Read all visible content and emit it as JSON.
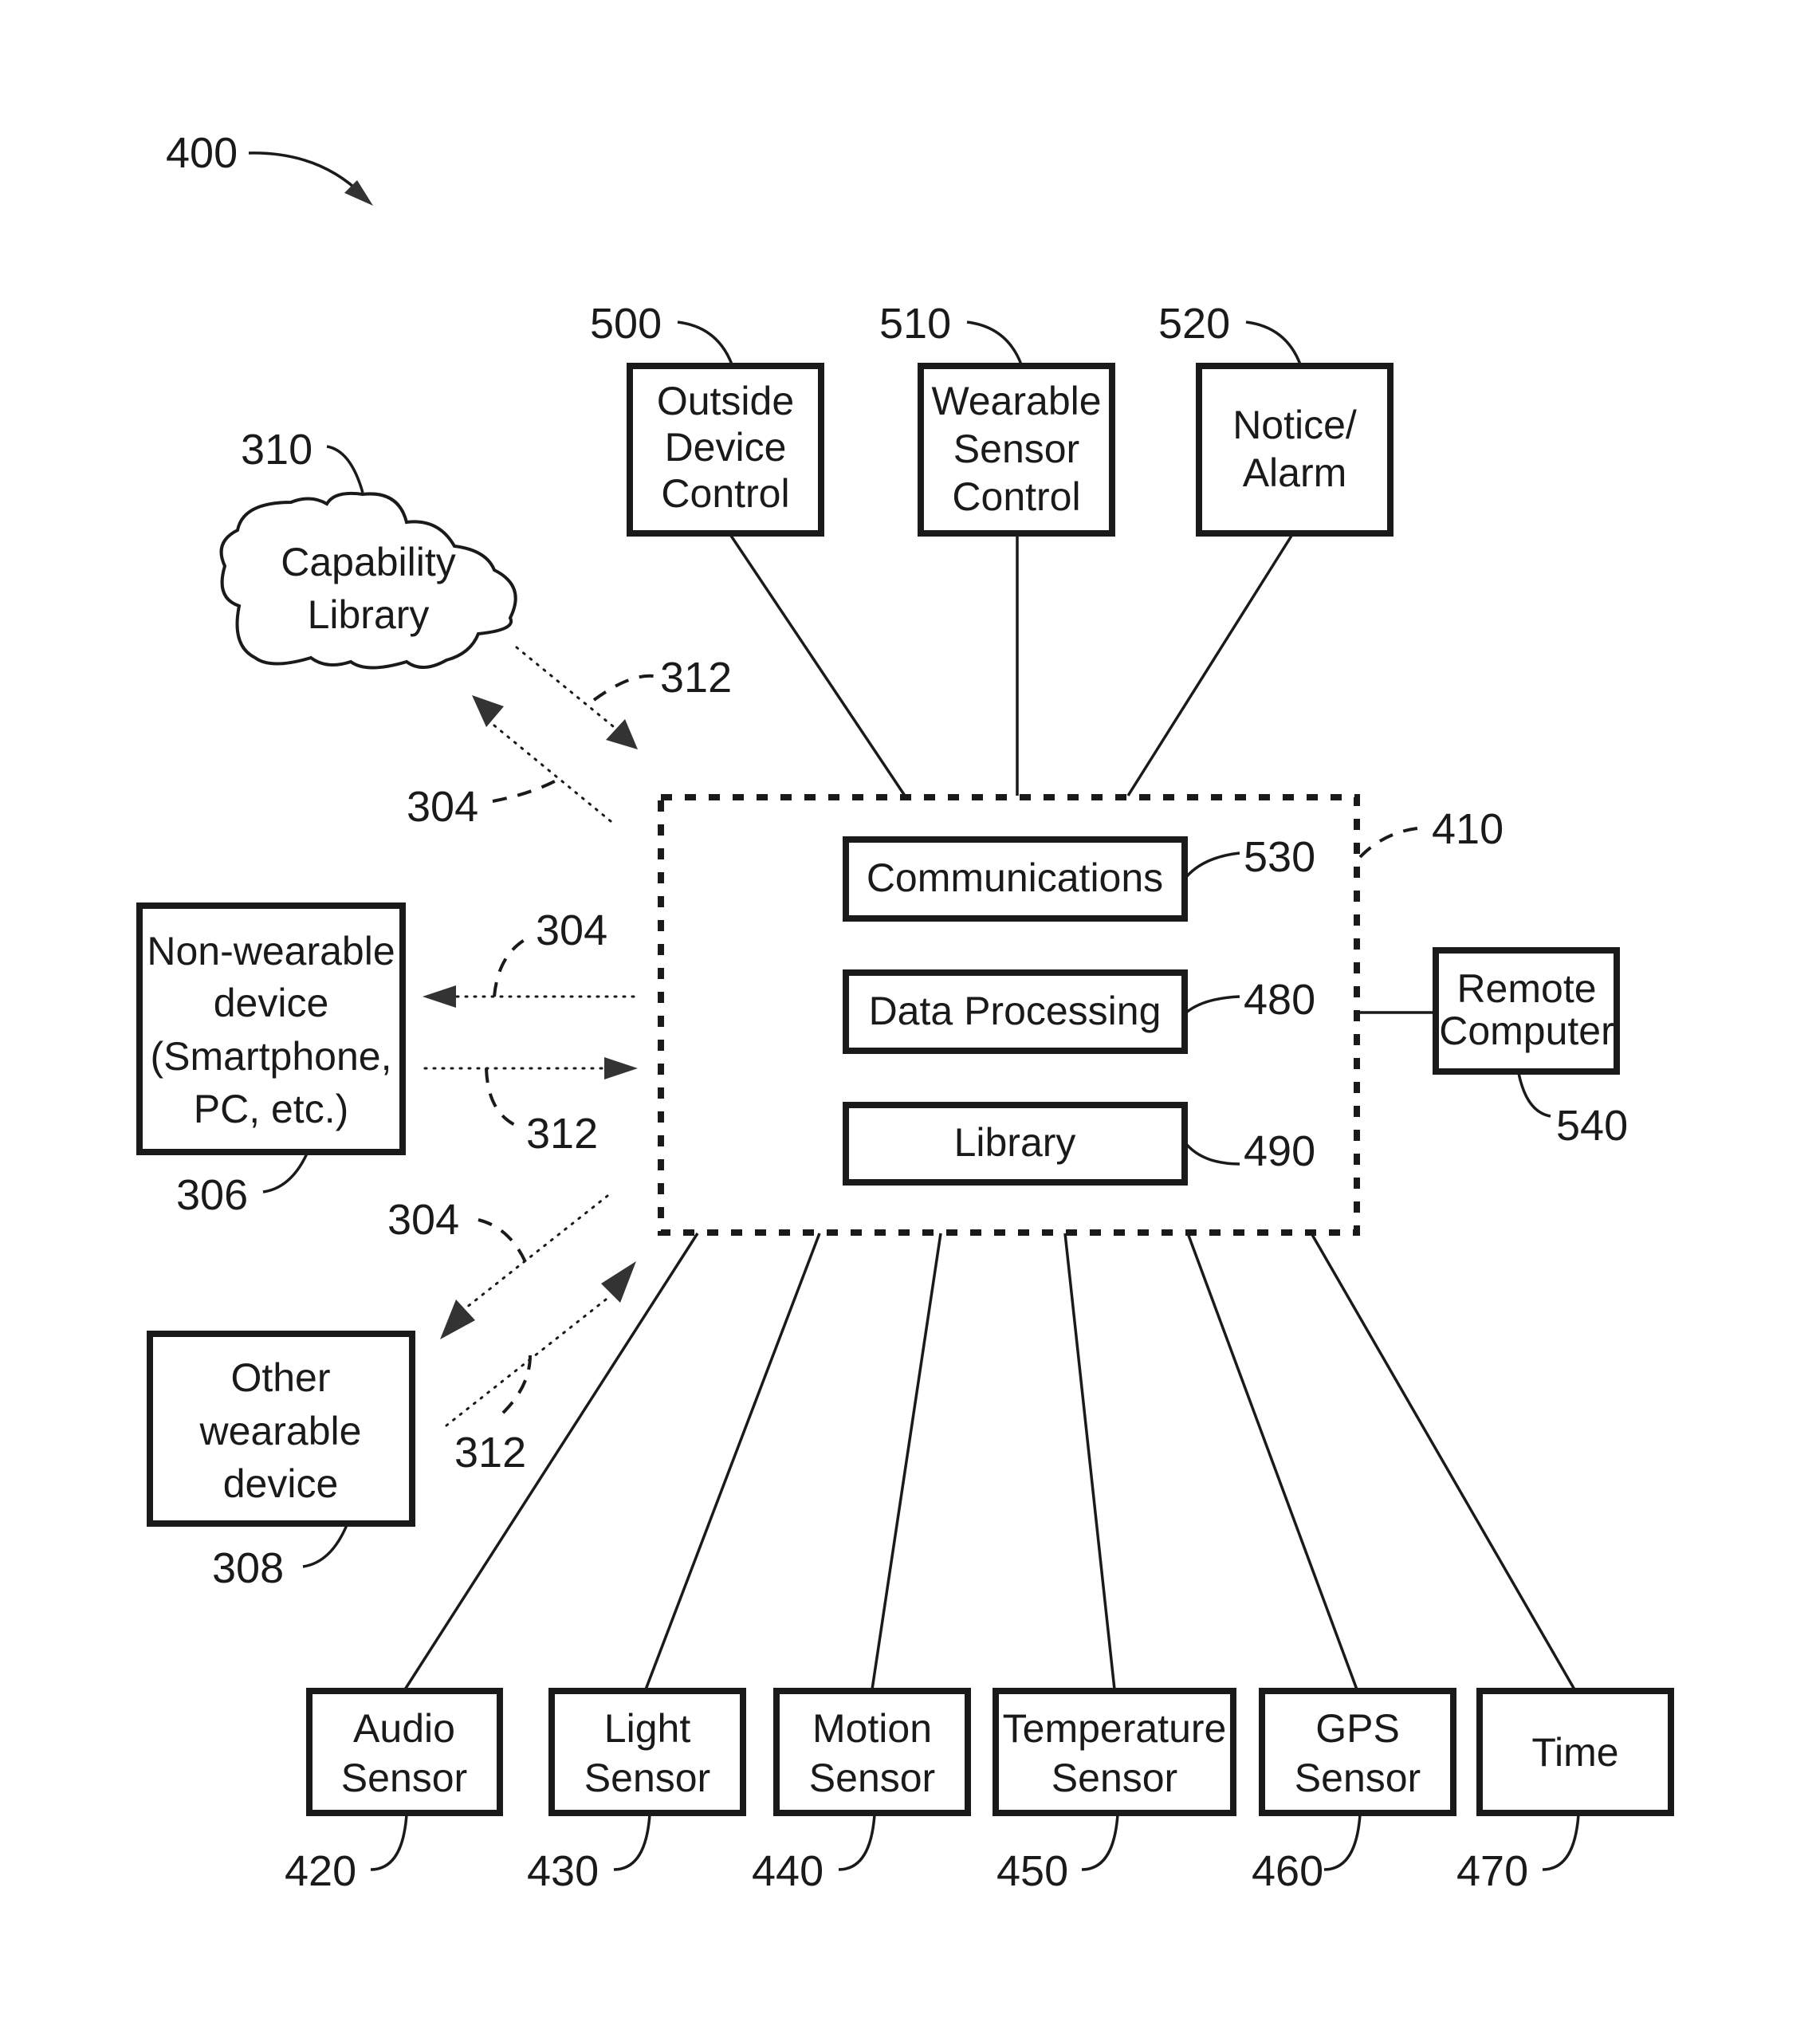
{
  "figure": {
    "ref": "400"
  },
  "cloud": {
    "ref": "310",
    "lines": [
      "Capability",
      "Library"
    ]
  },
  "top_boxes": [
    {
      "ref": "500",
      "lines": [
        "Outside",
        "Device",
        "Control"
      ]
    },
    {
      "ref": "510",
      "lines": [
        "Wearable",
        "Sensor",
        "Control"
      ]
    },
    {
      "ref": "520",
      "lines": [
        "Notice/",
        "Alarm"
      ]
    }
  ],
  "hub": {
    "ref": "410",
    "modules": [
      {
        "ref": "530",
        "label": "Communications"
      },
      {
        "ref": "480",
        "label": "Data Processing"
      },
      {
        "ref": "490",
        "label": "Library"
      }
    ]
  },
  "remote": {
    "ref": "540",
    "lines": [
      "Remote",
      "Computer"
    ]
  },
  "non_wearable": {
    "ref": "306",
    "lines": [
      "Non-wearable",
      "device",
      "(Smartphone,",
      "PC, etc.)"
    ]
  },
  "other_wearable": {
    "ref": "308",
    "lines": [
      "Other",
      "wearable",
      "device"
    ]
  },
  "links": {
    "cloud_in": "312",
    "cloud_out": "304",
    "nonwear_out": "304",
    "nonwear_in": "312",
    "other_out": "304",
    "other_in": "312"
  },
  "sensors": [
    {
      "ref": "420",
      "lines": [
        "Audio",
        "Sensor"
      ]
    },
    {
      "ref": "430",
      "lines": [
        "Light",
        "Sensor"
      ]
    },
    {
      "ref": "440",
      "lines": [
        "Motion",
        "Sensor"
      ]
    },
    {
      "ref": "450",
      "lines": [
        "Temperature",
        "Sensor"
      ]
    },
    {
      "ref": "460",
      "lines": [
        "GPS",
        "Sensor"
      ]
    },
    {
      "ref": "470",
      "lines": [
        "Time"
      ]
    }
  ]
}
